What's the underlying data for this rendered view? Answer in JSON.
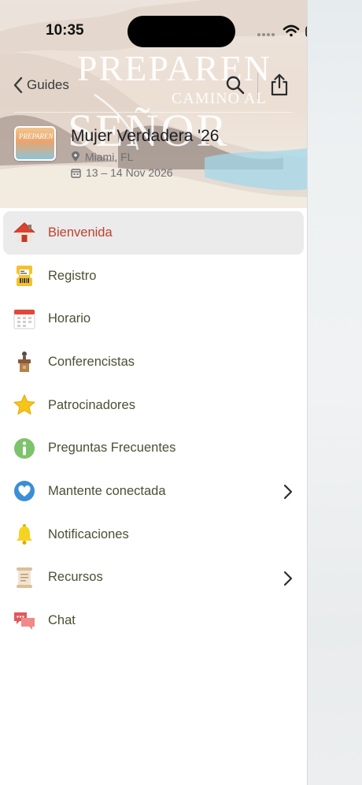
{
  "status_bar": {
    "time": "10:35"
  },
  "header": {
    "back_label": "Guides",
    "hero_title_line1": "PREPAREN",
    "hero_title_line2": "CAMINO AL",
    "hero_title_line3": "SEÑOR"
  },
  "event": {
    "name": "Mujer Verdadera '26",
    "location": "Miami, FL",
    "dates": "13 – 14 Nov 2026",
    "thumb_text": "PREPAREN"
  },
  "menu": {
    "items": [
      {
        "label": "Bienvenida",
        "icon": "house-icon",
        "active": true,
        "chevron": false
      },
      {
        "label": "Registro",
        "icon": "ticket-icon",
        "active": false,
        "chevron": false
      },
      {
        "label": "Horario",
        "icon": "calendar-icon",
        "active": false,
        "chevron": false
      },
      {
        "label": "Conferencistas",
        "icon": "podium-icon",
        "active": false,
        "chevron": false
      },
      {
        "label": "Patrocinadores",
        "icon": "star-icon",
        "active": false,
        "chevron": false
      },
      {
        "label": "Preguntas Frecuentes",
        "icon": "info-icon",
        "active": false,
        "chevron": false
      },
      {
        "label": "Mantente conectada",
        "icon": "heart-icon",
        "active": false,
        "chevron": true
      },
      {
        "label": "Notificaciones",
        "icon": "bell-icon",
        "active": false,
        "chevron": false
      },
      {
        "label": "Recursos",
        "icon": "scroll-icon",
        "active": false,
        "chevron": true
      },
      {
        "label": "Chat",
        "icon": "chat-bubbles-icon",
        "active": false,
        "chevron": false
      }
    ]
  },
  "colors": {
    "active_label": "#c0402c",
    "label": "#4a5033",
    "active_row_bg": "#ebebeb"
  }
}
